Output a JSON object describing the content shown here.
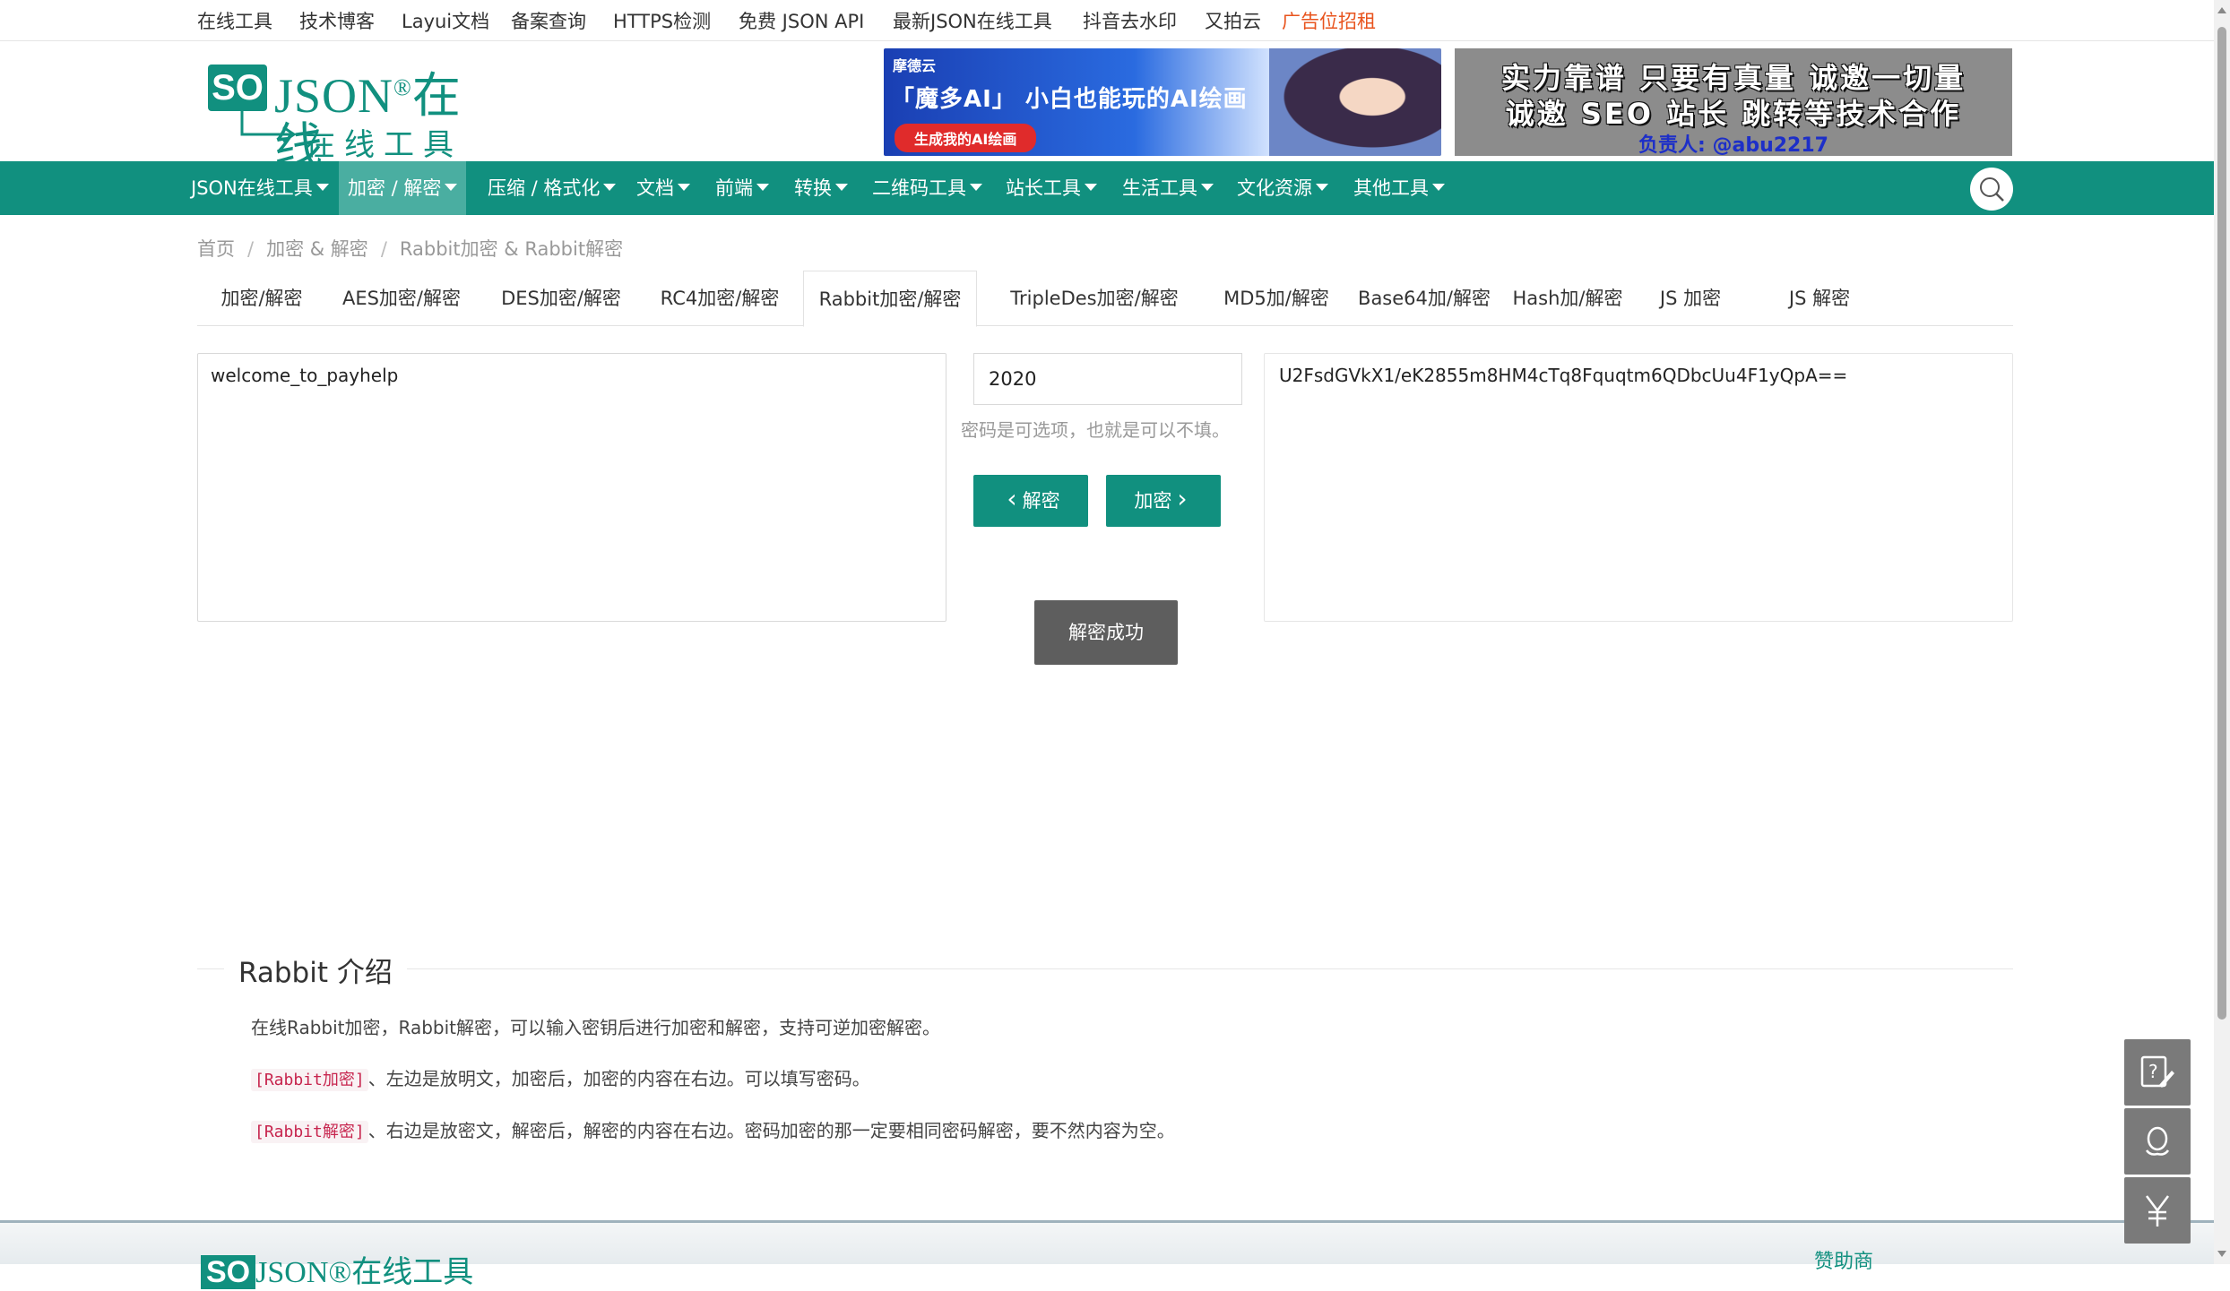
{
  "topbar": {
    "links": [
      "在线工具",
      "技术博客",
      "Layui文档",
      "备案查询",
      "HTTPS检测",
      "免费 JSON API",
      "最新JSON在线工具",
      "抖音去水印",
      "又拍云"
    ],
    "ad_link": "广告位招租"
  },
  "logo": {
    "so": "SO",
    "json": "JSON",
    "registered": "®",
    "online": "在线",
    "subtitle": "在线工具箱"
  },
  "banner1": {
    "brand": "摩德云",
    "headline": "「魔多AI」 小白也能玩的AI绘画",
    "cta": "生成我的AI绘画"
  },
  "banner2": {
    "line1": "实力靠谱 只要有真量 诚邀一切量",
    "line2": "诚邀 SEO 站长 跳转等技术合作",
    "line3": "负责人: @abu2217"
  },
  "nav": {
    "items": [
      "JSON在线工具",
      "加密 / 解密",
      "压缩 / 格式化",
      "文档",
      "前端",
      "转换",
      "二维码工具",
      "站长工具",
      "生活工具",
      "文化资源",
      "其他工具"
    ],
    "active_index": 1
  },
  "breadcrumb": {
    "home": "首页",
    "category": "加密 & 解密",
    "current": "Rabbit加密 & Rabbit解密"
  },
  "tabs": {
    "items": [
      "加密/解密",
      "AES加密/解密",
      "DES加密/解密",
      "RC4加密/解密",
      "Rabbit加密/解密",
      "TripleDes加密/解密",
      "MD5加/解密",
      "Base64加/解密",
      "Hash加/解密",
      "JS 加密",
      "JS 解密"
    ],
    "active_index": 4
  },
  "editor": {
    "plaintext": "welcome_to_payhelp",
    "password": "2020",
    "password_hint": "密码是可选项，也就是可以不填。",
    "decrypt_label": "解密",
    "encrypt_label": "加密",
    "ciphertext": "U2FsdGVkX1/eK2855m8HM4cTq8Fquqtm6QDbcUu4F1yQpA==",
    "toast": "解密成功"
  },
  "intro": {
    "title": "Rabbit 介绍",
    "p1": "在线Rabbit加密，Rabbit解密，可以输入密钥后进行加密和解密，支持可逆加密解密。",
    "p2_tag": "[Rabbit加密]",
    "p2_text": "、左边是放明文，加密后，加密的内容在右边。可以填写密码。",
    "p3_tag": "[Rabbit解密]",
    "p3_text": "、右边是放密文，解密后，解密的内容在右边。密码加密的那一定要相同密码解密，要不然内容为空。"
  },
  "footer": {
    "logo_so": "SO",
    "logo_text": "JSON®在线工具",
    "sponsor": "赞助商"
  },
  "colors": {
    "brand": "#11907f",
    "nav_active": "#4aaea1",
    "ad_link": "#e8541e",
    "toast": "#5e5e5e"
  }
}
